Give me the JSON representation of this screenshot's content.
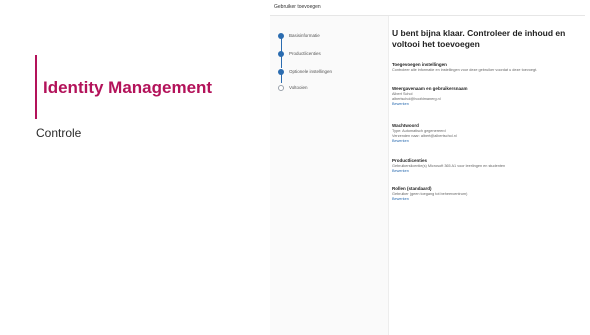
{
  "slide": {
    "title": "Identity Management",
    "subtitle": "Controle"
  },
  "wizard": {
    "header": "Gebruiker toevoegen",
    "steps": [
      {
        "label": "Basisinformatie",
        "done": true
      },
      {
        "label": "Productlicenties",
        "done": true
      },
      {
        "label": "Optionele instellingen",
        "done": true
      },
      {
        "label": "Voltooien",
        "done": false
      }
    ],
    "title": "U bent bijna klaar. Controleer de inhoud en voltooi het toevoegen",
    "sections": [
      {
        "heading": "Toegevoegen instellingen",
        "lines": [
          "Controleer alle informatie en instellingen voor deze gebruiker voordat u deze toevoegt."
        ],
        "link": ""
      },
      {
        "heading": "Weergavenaam en gebruikersnaam",
        "lines": [
          "Albert Schol",
          "albertschol@hoofdmanerg.nl"
        ],
        "link": "Bewerken"
      },
      {
        "heading": "Wachtwoord",
        "lines": [
          "Type: Automatisch gegenereerd",
          "Verzenden naar: albert@albertschol.nl"
        ],
        "link": "Bewerken"
      },
      {
        "heading": "Productlicenties",
        "lines": [
          "Gebruikerslicentie(s) Microsoft 365 A1 voor leerlingen en studenten"
        ],
        "link": "Bewerken"
      },
      {
        "heading": "Rollen (standaard)",
        "lines": [
          "Gebruiker (geen toegang tot beheercentrum)"
        ],
        "link": "Bewerken"
      }
    ]
  }
}
